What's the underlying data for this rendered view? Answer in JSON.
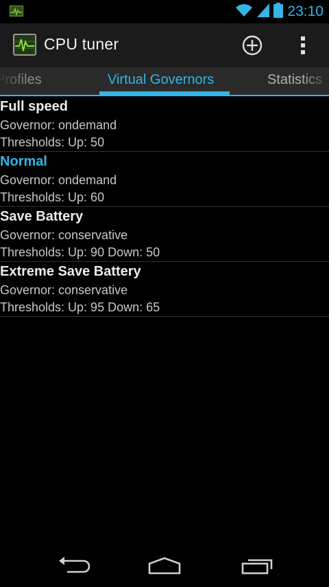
{
  "status_bar": {
    "time": "23:10",
    "icons": [
      "cpu-monitor-icon",
      "wifi-icon",
      "signal-icon",
      "battery-icon"
    ]
  },
  "action_bar": {
    "title": "CPU tuner",
    "actions": [
      "add-icon",
      "overflow-menu-icon"
    ]
  },
  "tabs": [
    {
      "label": "Profiles",
      "selected": false
    },
    {
      "label": "Virtual Governors",
      "selected": true
    },
    {
      "label": "Statistics",
      "selected": false
    }
  ],
  "governors": [
    {
      "name": "Full speed",
      "governor": "Governor: ondemand",
      "thresholds": "Thresholds: Up: 50",
      "active": false
    },
    {
      "name": "Normal",
      "governor": "Governor: ondemand",
      "thresholds": "Thresholds: Up: 60",
      "active": true
    },
    {
      "name": "Save Battery",
      "governor": "Governor: conservative",
      "thresholds": "Thresholds: Up: 90 Down: 50",
      "active": false
    },
    {
      "name": "Extreme Save Battery",
      "governor": "Governor: conservative",
      "thresholds": "Thresholds: Up: 95 Down: 65",
      "active": false
    }
  ],
  "nav_bar": {
    "buttons": [
      "back-icon",
      "home-icon",
      "recent-apps-icon"
    ]
  },
  "colors": {
    "accent": "#33b5e5",
    "background": "#000000",
    "action_bar": "#1b1b1b",
    "tab_strip": "#2a2a2a"
  }
}
